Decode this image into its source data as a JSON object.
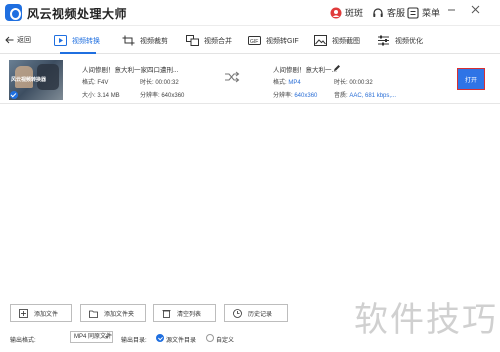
{
  "app": {
    "title": "风云视频处理大师"
  },
  "titlebar": {
    "user_label": "斑斑",
    "service_label": "客服",
    "menu_label": "菜单"
  },
  "nav": {
    "back_label": "返回",
    "tabs": [
      {
        "label": "视频转换",
        "active": true
      },
      {
        "label": "视频裁剪",
        "active": false
      },
      {
        "label": "视频合并",
        "active": false
      },
      {
        "label": "视频转GIF",
        "active": false
      },
      {
        "label": "视频截图",
        "active": false
      },
      {
        "label": "视频优化",
        "active": false
      }
    ]
  },
  "file": {
    "thumb_caption": "风云视频转换器",
    "source": {
      "name": "人间惨剧！意大利一家四口遭刑...",
      "format_label": "格式:",
      "format": "F4V",
      "duration_label": "时长:",
      "duration": "00:00:32",
      "size_label": "大小:",
      "size": "3.14 MB",
      "resolution_label": "分辨率:",
      "resolution": "640x360"
    },
    "output": {
      "name": "人间惨剧！意大利一...",
      "format_label": "格式:",
      "format": "MP4",
      "duration_label": "时长:",
      "duration": "00:00:32",
      "resolution_label": "分辨率:",
      "resolution": "640x360",
      "audio_label": "音质:",
      "audio": "AAC, 681 kbps,..."
    },
    "open_label": "打开"
  },
  "footer": {
    "buttons": {
      "add_file": "添加文件",
      "add_folder": "添加文件夹",
      "clear_list": "清空列表",
      "history": "历史记录"
    },
    "output_format_label": "输出格式:",
    "output_format_value": "MP4 同原文件",
    "output_dir_label": "输出目录:",
    "dir_option_source": "源文件目录",
    "dir_option_custom": "自定义"
  },
  "watermark": "软件技巧",
  "colors": {
    "accent": "#1f6fe0",
    "open_button": "#2f74e6",
    "highlight_border": "#d93030"
  }
}
